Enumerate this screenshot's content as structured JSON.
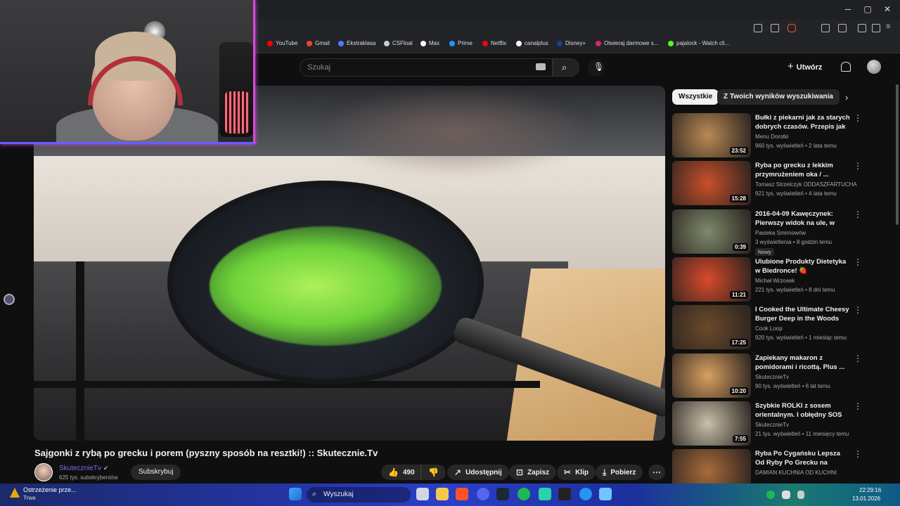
{
  "window": {
    "minimize": "─",
    "maximize": "▢",
    "close": "✕"
  },
  "bookmarks": [
    {
      "label": "YouTube",
      "color": "#ff0000"
    },
    {
      "label": "Gmail",
      "color": "#ea4335"
    },
    {
      "label": "Ekstraklasa",
      "color": "#4a7cff"
    },
    {
      "label": "CSFloat",
      "color": "#cccccc"
    },
    {
      "label": "Max",
      "color": "#ffffff"
    },
    {
      "label": "Prime",
      "color": "#1a98ff"
    },
    {
      "label": "Netflix",
      "color": "#e50914"
    },
    {
      "label": "canalplus",
      "color": "#ffffff"
    },
    {
      "label": "Disney+",
      "color": "#1b3e9e"
    },
    {
      "label": "Otwieraj darmowe s...",
      "color": "#d12a6a"
    },
    {
      "label": "pajalock - Watch cli...",
      "color": "#53fc18"
    }
  ],
  "youtube": {
    "search_placeholder": "Szukaj",
    "create_label": "Utwórz"
  },
  "video": {
    "title": "Sajgonki z rybą po grecku i porem (pyszny sposób na resztki!) :: Skutecznie.Tv",
    "channel": "SkutecznieTv",
    "subscribers": "625 tys. subskrybentów",
    "subscribe_label": "Subskrybuj",
    "likes": "490",
    "share_label": "Udostępnij",
    "save_label": "Zapisz",
    "clip_label": "Klip",
    "download_label": "Pobierz"
  },
  "chips": [
    "Wszystkie",
    "Z Twoich wyników wyszukiwania"
  ],
  "recommendations": [
    {
      "title": "Bułki z piekarni jak za starych dobrych czasów. Przepis jak ...",
      "channel": "Menu Dorotki",
      "meta": "960 tys. wyświetleń • 2 lata temu",
      "duration": "23:52",
      "thumb": "#b98a55",
      "badge": ""
    },
    {
      "title": "Ryba po grecku z lekkim przymrużeniem oka / ...",
      "channel": "Tomasz Strzelczyk ODDASZFARTUCHA",
      "meta": "921 tys. wyświetleń • 4 lata temu",
      "duration": "15:28",
      "thumb": "#c8502a",
      "badge": ""
    },
    {
      "title": "2016-04-09 Kawęczynek: Pierwszy widok na ule, w nocy...",
      "channel": "Pasieka Smirnowów",
      "meta": "3 wyświetlenia • 8 godzin temu",
      "duration": "0:39",
      "thumb": "#7d8a6a",
      "badge": "Nowy"
    },
    {
      "title": "Ulubione Produkty Dietetyka w Biedronce! 🍓",
      "channel": "Michał Wrzosek",
      "meta": "221 tys. wyświetleń • 8 dni temu",
      "duration": "11:21",
      "thumb": "#d84a2a",
      "badge": ""
    },
    {
      "title": "I Cooked the Ultimate Cheesy Burger Deep in the Woods",
      "channel": "Cook Loop",
      "meta": "920 tys. wyświetleń • 1 miesiąc temu",
      "duration": "17:25",
      "thumb": "#6a4a2a",
      "badge": ""
    },
    {
      "title": "Zapiekany makaron z pomidorami i ricottą. Plus ...",
      "channel": "SkutecznieTv",
      "meta": "90 tys. wyświetleń • 6 lat temu",
      "duration": "10:20",
      "thumb": "#d8a060",
      "badge": ""
    },
    {
      "title": "Szybkie ROLKI z sosem orientalnym. I obłędny SOS do ...",
      "channel": "SkutecznieTv",
      "meta": "21 tys. wyświetleń • 11 miesięcy temu",
      "duration": "7:55",
      "thumb": "#c8c0a8",
      "badge": ""
    },
    {
      "title": "Ryba Po Cygańsku Lepsza Od Ryby Po Grecku na WIGILĘ I ...",
      "channel": "DAMIAN KUCHNIA OD KUCHNI",
      "meta": "",
      "duration": "",
      "thumb": "#a86a3a",
      "badge": ""
    }
  ],
  "taskbar": {
    "notification_title": "Ostrzeżenie prze...",
    "notification_sub": "Trwa",
    "search_label": "Wyszukaj",
    "time": "22:29:16",
    "date": "13.01.2026"
  }
}
